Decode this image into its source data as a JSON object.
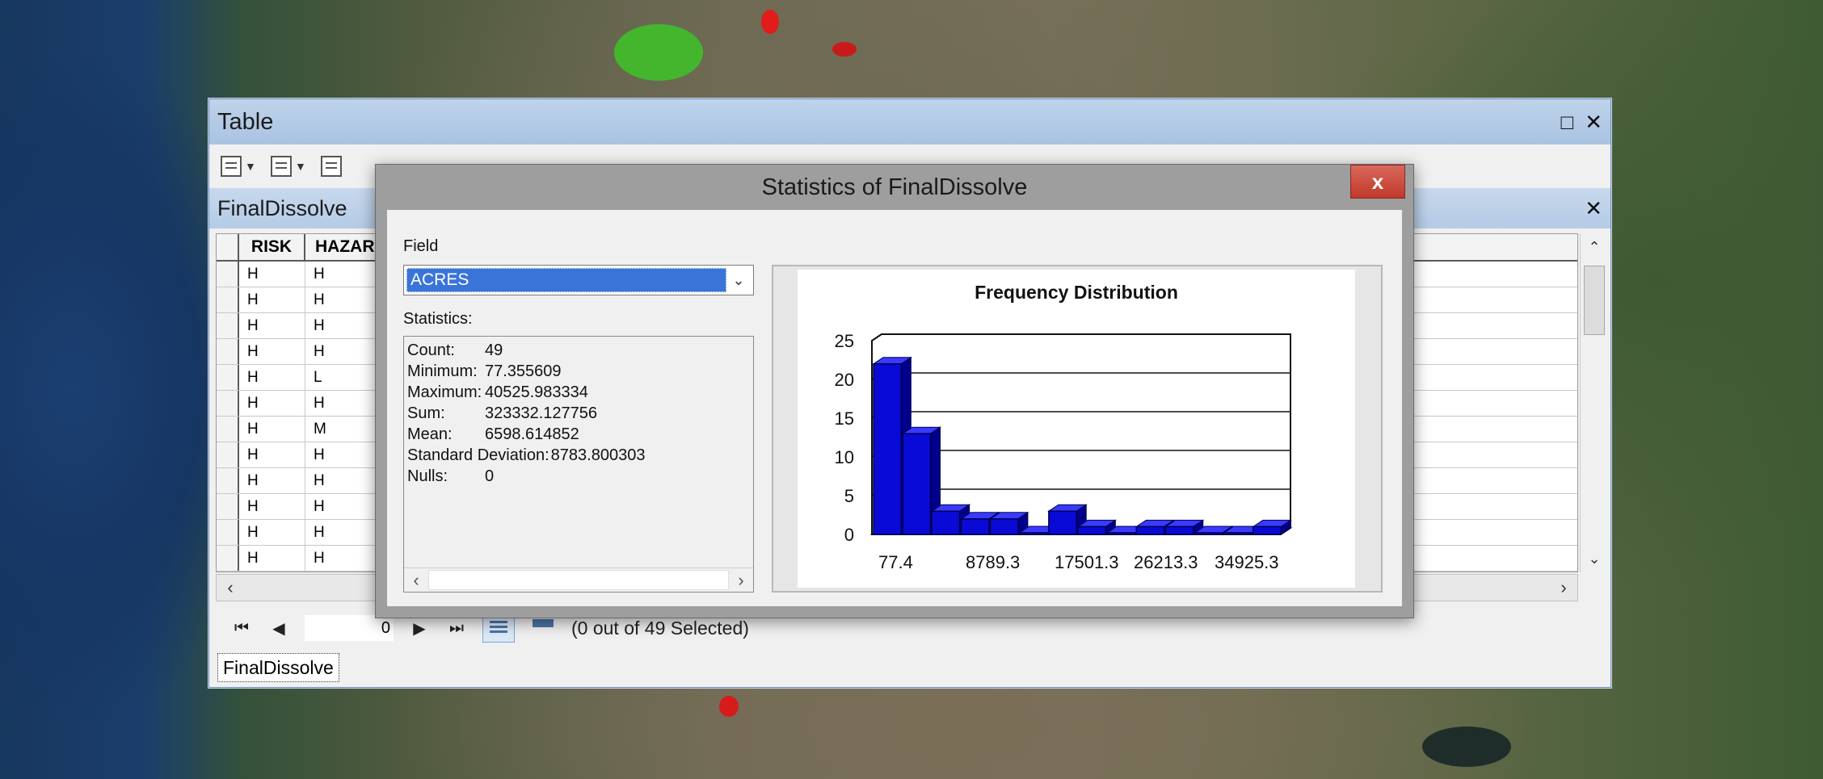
{
  "table_window": {
    "title": "Table",
    "tab_title": "FinalDissolve",
    "columns": [
      "RISK",
      "HAZAR"
    ],
    "rows": [
      [
        "H",
        "H"
      ],
      [
        "H",
        "H"
      ],
      [
        "H",
        "H"
      ],
      [
        "H",
        "H"
      ],
      [
        "H",
        "L"
      ],
      [
        "H",
        "H"
      ],
      [
        "H",
        "M"
      ],
      [
        "H",
        "H"
      ],
      [
        "H",
        "H"
      ],
      [
        "H",
        "H"
      ],
      [
        "H",
        "H"
      ],
      [
        "H",
        "H"
      ]
    ],
    "record_index": "0",
    "selection_text": "(0 out of 49 Selected)",
    "bottom_tab": "FinalDissolve"
  },
  "dialog": {
    "title": "Statistics of FinalDissolve",
    "close_label": "x",
    "field_label": "Field",
    "field_value": "ACRES",
    "statistics_label": "Statistics:",
    "stats": [
      {
        "key": "Count:",
        "value": "49"
      },
      {
        "key": "Minimum:",
        "value": "77.355609"
      },
      {
        "key": "Maximum:",
        "value": "40525.983334"
      },
      {
        "key": "Sum:",
        "value": "323332.127756"
      },
      {
        "key": "Mean:",
        "value": "6598.614852"
      },
      {
        "key": "Standard Deviation:",
        "value": "8783.800303"
      },
      {
        "key": "Nulls:",
        "value": "0"
      }
    ]
  },
  "chart_data": {
    "type": "bar",
    "title": "Frequency Distribution",
    "xlabel": "",
    "ylabel": "",
    "ylim": [
      0,
      25
    ],
    "y_ticks": [
      "0",
      "5",
      "10",
      "15",
      "20",
      "25"
    ],
    "x_ticks": [
      "77.4",
      "8789.3",
      "17501.3",
      "26213.3",
      "34925.3"
    ],
    "values": [
      22,
      13,
      3,
      2,
      2,
      0,
      3,
      1,
      0,
      1,
      1,
      0,
      0,
      1
    ],
    "bar_color": "#0a0ad6",
    "grid": true
  },
  "colors": {
    "dialog_close": "#c0392b",
    "selection_blue": "#3a74d8",
    "bar": "#0a0ad6"
  }
}
